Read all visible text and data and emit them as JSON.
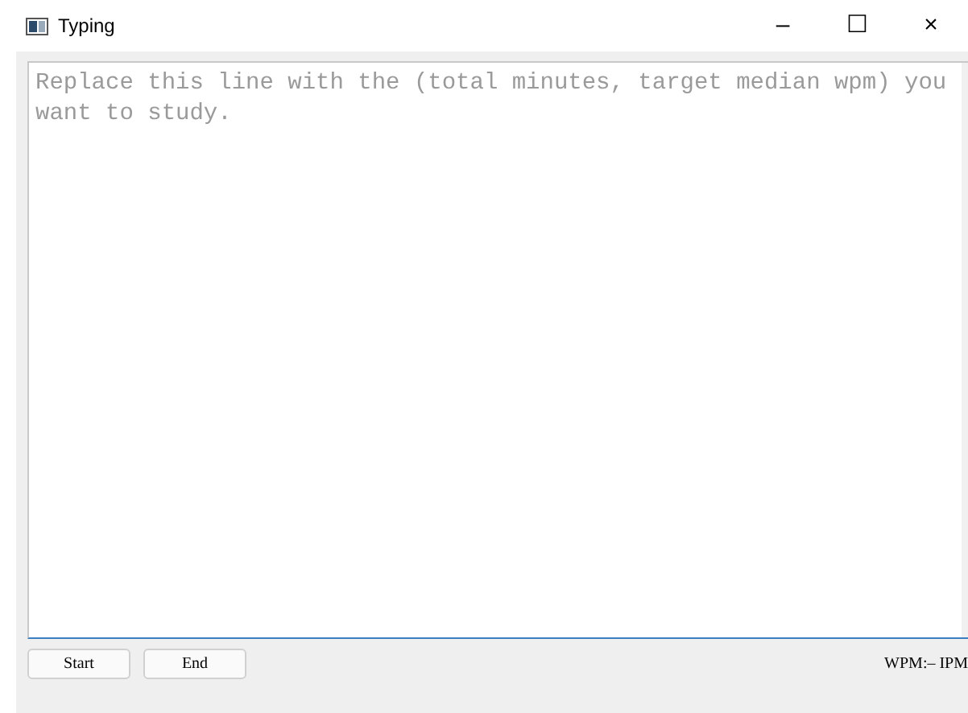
{
  "window": {
    "title": "Typing",
    "controls": [
      "–",
      "☐",
      "×"
    ]
  },
  "editor": {
    "placeholder": "Replace this line with the (total minutes, target median wpm) you want to study."
  },
  "buttons": [
    "Start",
    "End"
  ],
  "status": "WPM:– IPM"
}
